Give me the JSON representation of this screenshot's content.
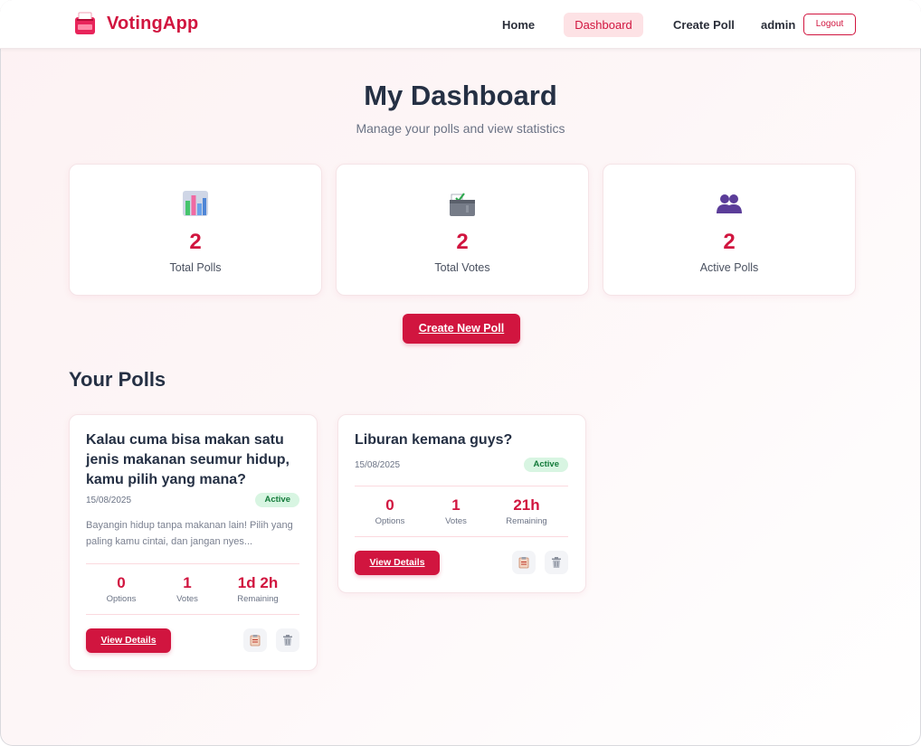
{
  "brand": {
    "name": "VotingApp"
  },
  "nav": {
    "home": "Home",
    "dashboard": "Dashboard",
    "create_poll": "Create Poll",
    "user": "admin",
    "logout": "Logout"
  },
  "header": {
    "title": "My Dashboard",
    "subtitle": "Manage your polls and view statistics"
  },
  "stats": [
    {
      "icon": "bar-chart-icon",
      "value": "2",
      "label": "Total Polls"
    },
    {
      "icon": "ballot-box-icon",
      "value": "2",
      "label": "Total Votes"
    },
    {
      "icon": "users-icon",
      "value": "2",
      "label": "Active Polls"
    }
  ],
  "create_button": "Create New Poll",
  "section_title": "Your Polls",
  "polls": [
    {
      "title": "Kalau cuma bisa makan satu jenis makanan seumur hidup, kamu pilih yang mana?",
      "date": "15/08/2025",
      "status": "Active",
      "description": "Bayangin hidup tanpa makanan lain! Pilih yang paling kamu cintai, dan jangan nyes...",
      "options_value": "0",
      "options_label": "Options",
      "votes_value": "1",
      "votes_label": "Votes",
      "remaining_value": "1d 2h",
      "remaining_label": "Remaining",
      "view_label": "View Details"
    },
    {
      "title": "Liburan kemana guys?",
      "date": "15/08/2025",
      "status": "Active",
      "options_value": "0",
      "options_label": "Options",
      "votes_value": "1",
      "votes_label": "Votes",
      "remaining_value": "21h",
      "remaining_label": "Remaining",
      "view_label": "View Details"
    }
  ],
  "colors": {
    "accent": "#d1153f",
    "active_badge_bg": "#d8f5e2",
    "active_badge_text": "#137a3a",
    "heading": "#253044"
  }
}
